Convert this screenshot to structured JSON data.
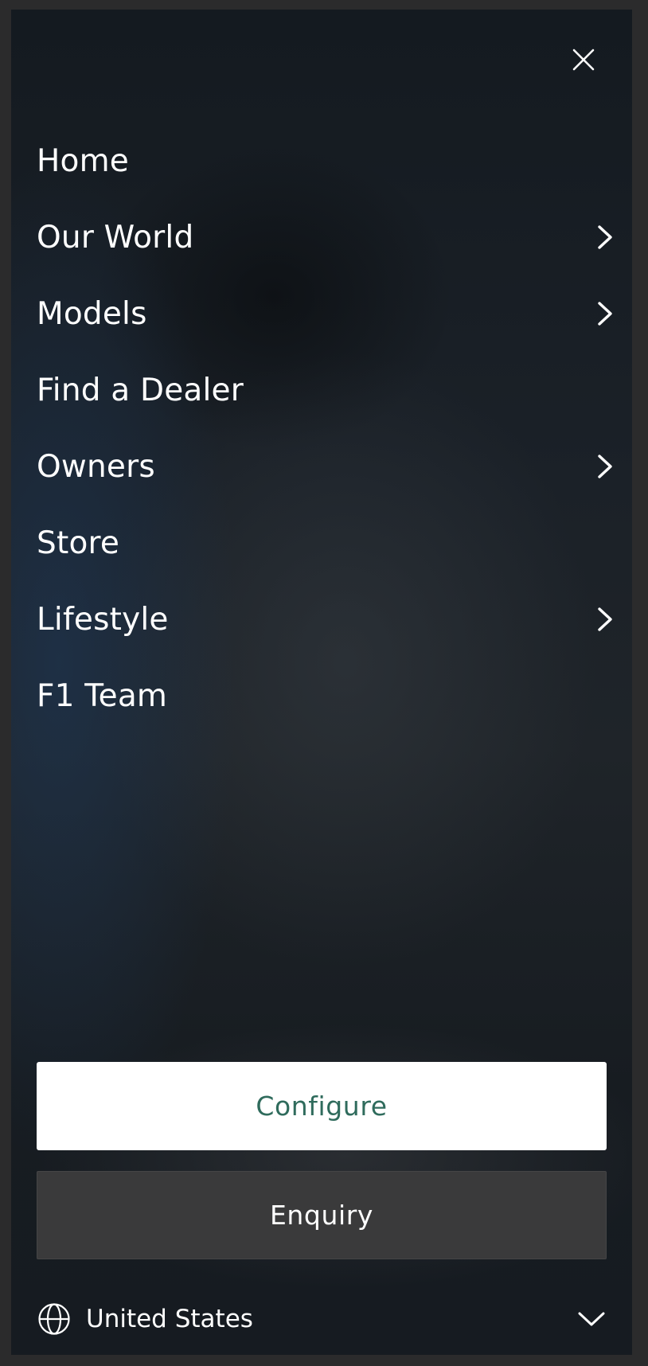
{
  "menu": {
    "close_icon": "close-icon",
    "items": [
      {
        "label": "Home",
        "has_submenu": false
      },
      {
        "label": "Our World",
        "has_submenu": true
      },
      {
        "label": "Models",
        "has_submenu": true
      },
      {
        "label": "Find a Dealer",
        "has_submenu": false
      },
      {
        "label": "Owners",
        "has_submenu": true
      },
      {
        "label": "Store",
        "has_submenu": false
      },
      {
        "label": "Lifestyle",
        "has_submenu": true
      },
      {
        "label": "F1 Team",
        "has_submenu": false
      }
    ]
  },
  "actions": {
    "configure_label": "Configure",
    "enquiry_label": "Enquiry"
  },
  "region": {
    "selected": "United States",
    "icon": "globe-icon"
  },
  "colors": {
    "configure_text": "#2f6b5c",
    "panel_dark": "#171c21",
    "enquiry_bg": "#3a3a3b"
  }
}
